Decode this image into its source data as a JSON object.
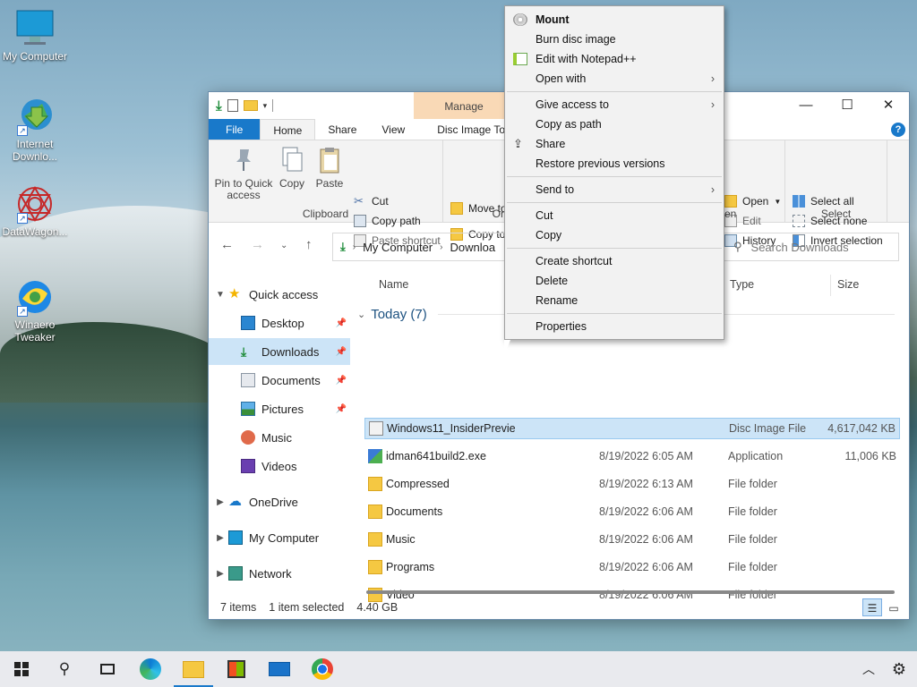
{
  "desktop": {
    "icons": [
      {
        "label": "My Computer",
        "icon": "computer-icon"
      },
      {
        "label": "Internet Downlo...",
        "icon": "idm-icon"
      },
      {
        "label": "DataWagon...",
        "icon": "datawagon-icon"
      },
      {
        "label": "Winaero Tweaker",
        "icon": "winaero-icon"
      }
    ]
  },
  "window": {
    "contextual_tab": "Manage",
    "controls": {
      "minimize": "—",
      "maximize": "☐",
      "close": "✕"
    },
    "tabs": [
      "File",
      "Home",
      "Share",
      "View",
      "Disc Image Tools"
    ],
    "ribbon": {
      "clipboard": {
        "pin": "Pin to Quick access",
        "copy": "Copy",
        "paste": "Paste",
        "cut": "Cut",
        "copy_path": "Copy path",
        "paste_shortcut": "Paste shortcut",
        "label": "Clipboard"
      },
      "organize": {
        "move_to": "Move to",
        "copy_to": "Copy to",
        "label": "Or"
      },
      "open": {
        "open": "Open",
        "edit": "Edit",
        "history": "History",
        "label": "en"
      },
      "select": {
        "select_all": "Select all",
        "select_none": "Select none",
        "invert": "Invert selection",
        "label": "Select"
      }
    },
    "address": {
      "crumbs": [
        "My Computer",
        "Downloa"
      ],
      "search_placeholder": "Search Downloads"
    },
    "nav": {
      "items": [
        {
          "label": "Quick access",
          "icon": "star-icon"
        },
        {
          "label": "Desktop",
          "icon": "desktop-icon"
        },
        {
          "label": "Downloads",
          "icon": "download-icon"
        },
        {
          "label": "Documents",
          "icon": "documents-icon"
        },
        {
          "label": "Pictures",
          "icon": "pictures-icon"
        },
        {
          "label": "Music",
          "icon": "music-icon"
        },
        {
          "label": "Videos",
          "icon": "videos-icon"
        },
        {
          "label": "OneDrive",
          "icon": "cloud-icon"
        },
        {
          "label": "My Computer",
          "icon": "computer-icon"
        },
        {
          "label": "Network",
          "icon": "network-icon"
        }
      ]
    },
    "columns": {
      "name": "Name",
      "type": "Type",
      "size": "Size"
    },
    "group": "Today (7)",
    "files": [
      {
        "name": "Windows11_InsiderPrevie",
        "date": "",
        "type": "Disc Image File",
        "size": "4,617,042 KB",
        "icon": "disc-image-icon"
      },
      {
        "name": "idman641build2.exe",
        "date": "8/19/2022 6:05 AM",
        "type": "Application",
        "size": "11,006 KB",
        "icon": "exe-icon"
      },
      {
        "name": "Compressed",
        "date": "8/19/2022 6:13 AM",
        "type": "File folder",
        "size": "",
        "icon": "folder-icon"
      },
      {
        "name": "Documents",
        "date": "8/19/2022 6:06 AM",
        "type": "File folder",
        "size": "",
        "icon": "folder-icon"
      },
      {
        "name": "Music",
        "date": "8/19/2022 6:06 AM",
        "type": "File folder",
        "size": "",
        "icon": "folder-icon"
      },
      {
        "name": "Programs",
        "date": "8/19/2022 6:06 AM",
        "type": "File folder",
        "size": "",
        "icon": "folder-icon"
      },
      {
        "name": "Video",
        "date": "8/19/2022 6:06 AM",
        "type": "File folder",
        "size": "",
        "icon": "folder-icon"
      }
    ],
    "status": {
      "count": "7 items",
      "selected": "1 item selected",
      "size": "4.40 GB"
    }
  },
  "context_menu": {
    "items": [
      {
        "label": "Mount",
        "icon": "disc-icon",
        "bold": true
      },
      {
        "label": "Burn disc image"
      },
      {
        "label": "Edit with Notepad++",
        "icon": "notepadpp-icon"
      },
      {
        "label": "Open with",
        "submenu": true
      },
      {
        "sep": true
      },
      {
        "label": "Give access to",
        "submenu": true
      },
      {
        "label": "Copy as path"
      },
      {
        "label": "Share",
        "icon": "share-icon"
      },
      {
        "label": "Restore previous versions"
      },
      {
        "sep": true
      },
      {
        "label": "Send to",
        "submenu": true
      },
      {
        "sep": true
      },
      {
        "label": "Cut"
      },
      {
        "label": "Copy"
      },
      {
        "sep": true
      },
      {
        "label": "Create shortcut"
      },
      {
        "label": "Delete"
      },
      {
        "label": "Rename"
      },
      {
        "sep": true
      },
      {
        "label": "Properties"
      }
    ]
  },
  "taskbar": {
    "items": [
      "start-icon",
      "search-icon",
      "task-view-icon",
      "edge-icon",
      "file-explorer-icon",
      "store-icon",
      "mail-icon",
      "chrome-icon"
    ],
    "tray": [
      "chevron-up-icon",
      "gear-icon"
    ]
  }
}
